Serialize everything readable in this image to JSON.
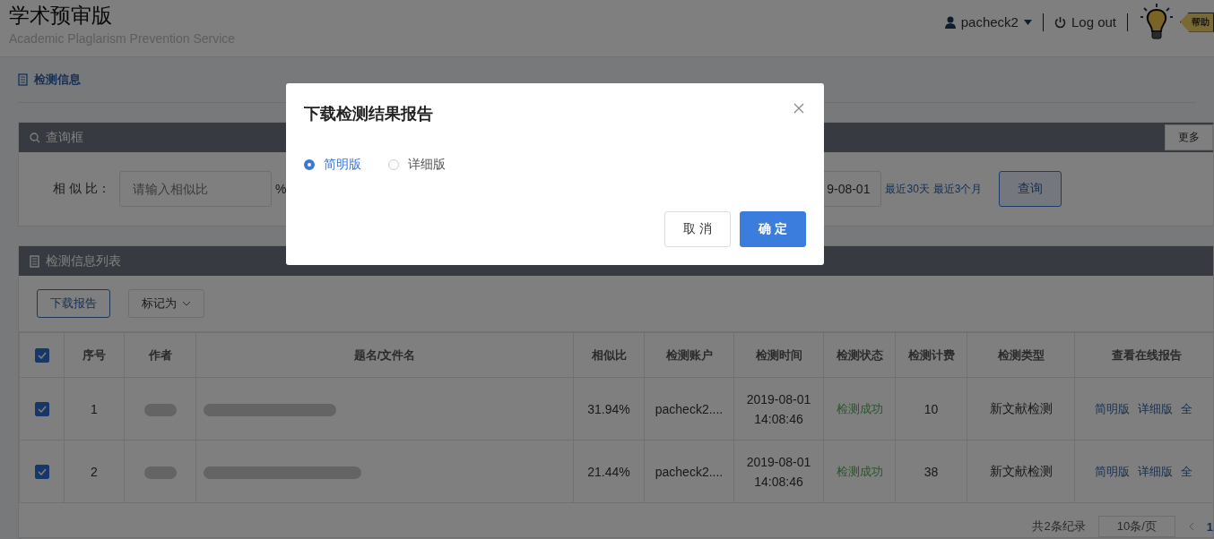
{
  "header": {
    "title": "学术预审版",
    "subtitle": "Academic Plaglarism Prevention Service",
    "user": "pacheck2",
    "logout": "Log out",
    "help": "帮助"
  },
  "breadcrumb": "检测信息",
  "query_panel": {
    "title": "查询框",
    "more_button": "更多",
    "similarity_label": "相 似 比：",
    "similarity_placeholder": "请输入相似比",
    "percent": "%",
    "date_end": "9-08-01",
    "quick_ranges": [
      "最近30天",
      "最近3个月"
    ],
    "search_button": "查询"
  },
  "list_panel": {
    "title": "检测信息列表",
    "download_button": "下载报告",
    "mark_button": "标记为",
    "all_checked": true,
    "columns": [
      "序号",
      "作者",
      "题名/文件名",
      "相似比",
      "检测账户",
      "检测时间",
      "检测状态",
      "检测计费",
      "检测类型",
      "查看在线报告"
    ],
    "rows": [
      {
        "checked": true,
        "index": "1",
        "similarity": "31.94%",
        "account": "pacheck2....",
        "date": "2019-08-01",
        "time": "14:08:46",
        "status": "检测成功",
        "fee": "10",
        "type": "新文献检测",
        "reports": [
          "简明版",
          "详细版",
          "全"
        ]
      },
      {
        "checked": true,
        "index": "2",
        "similarity": "21.44%",
        "account": "pacheck2....",
        "date": "2019-08-01",
        "time": "14:08:46",
        "status": "检测成功",
        "fee": "38",
        "type": "新文献检测",
        "reports": [
          "简明版",
          "详细版",
          "全"
        ]
      }
    ],
    "pagination": {
      "total": "共2条纪录",
      "page_size": "10条/页",
      "page": "1"
    }
  },
  "dialog": {
    "title": "下载检测结果报告",
    "options": [
      {
        "label": "简明版",
        "selected": true
      },
      {
        "label": "详细版",
        "selected": false
      }
    ],
    "cancel": "取 消",
    "confirm": "确 定"
  }
}
